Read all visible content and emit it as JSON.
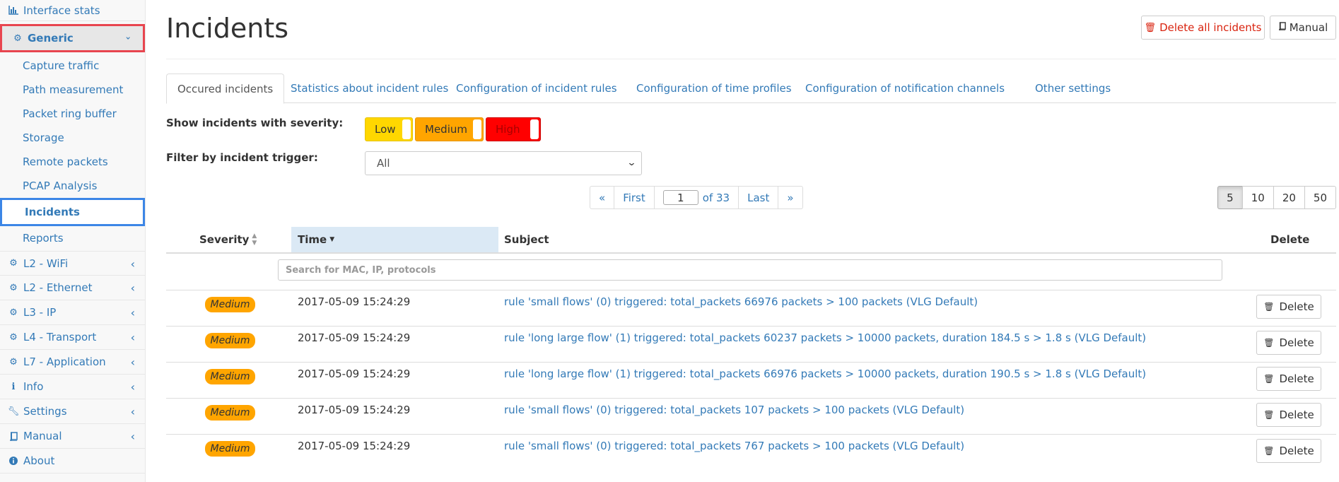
{
  "sidebar": {
    "items": [
      {
        "label": "Interface stats",
        "icon": "bar-chart-icon"
      },
      {
        "label": "Generic",
        "icon": "gear-icon"
      },
      {
        "label": "Capture traffic"
      },
      {
        "label": "Path measurement"
      },
      {
        "label": "Packet ring buffer"
      },
      {
        "label": "Storage"
      },
      {
        "label": "Remote packets"
      },
      {
        "label": "PCAP Analysis"
      },
      {
        "label": "Incidents"
      },
      {
        "label": "Reports"
      },
      {
        "label": "L2 - WiFi",
        "icon": "gear-icon"
      },
      {
        "label": "L2 - Ethernet",
        "icon": "gear-icon"
      },
      {
        "label": "L3 - IP",
        "icon": "gear-icon"
      },
      {
        "label": "L4 - Transport",
        "icon": "gear-icon"
      },
      {
        "label": "L7 - Application",
        "icon": "gear-icon"
      },
      {
        "label": "Info",
        "icon": "info-icon"
      },
      {
        "label": "Settings",
        "icon": "wrench-icon"
      },
      {
        "label": "Manual",
        "icon": "book-icon"
      },
      {
        "label": "About",
        "icon": "info-circle-icon"
      }
    ]
  },
  "header": {
    "title": "Incidents",
    "delete_all_label": "Delete all incidents",
    "manual_label": "Manual"
  },
  "tabs": [
    {
      "label": "Occured incidents"
    },
    {
      "label": "Statistics about incident rules"
    },
    {
      "label": "Configuration of incident rules"
    },
    {
      "label": "Configuration of time profiles"
    },
    {
      "label": "Configuration of notification channels"
    },
    {
      "label": "Other settings"
    }
  ],
  "filters": {
    "severity_label": "Show incidents with severity:",
    "severity_options": [
      "Low",
      "Medium",
      "High"
    ],
    "trigger_label": "Filter by incident trigger:",
    "trigger_value": "All"
  },
  "pagination": {
    "prev": "«",
    "first": "First",
    "current_page": "1",
    "of_pages": "of 33",
    "last": "Last",
    "next": "»",
    "page_sizes": [
      "5",
      "10",
      "20",
      "50"
    ],
    "active_page_size": "5"
  },
  "table": {
    "headers": {
      "severity": "Severity",
      "time": "Time",
      "subject": "Subject",
      "delete": "Delete"
    },
    "search_placeholder": "Search for MAC, IP, protocols",
    "delete_label": "Delete",
    "rows": [
      {
        "severity": "Medium",
        "time": "2017-05-09 15:24:29",
        "subject": "rule 'small flows' (0) triggered: total_packets 66976 packets > 100 packets (VLG Default)"
      },
      {
        "severity": "Medium",
        "time": "2017-05-09 15:24:29",
        "subject": "rule 'long large flow' (1) triggered: total_packets 60237 packets > 10000 packets, duration 184.5 s > 1.8 s (VLG Default)"
      },
      {
        "severity": "Medium",
        "time": "2017-05-09 15:24:29",
        "subject": "rule 'long large flow' (1) triggered: total_packets 66976 packets > 10000 packets, duration 190.5 s > 1.8 s (VLG Default)"
      },
      {
        "severity": "Medium",
        "time": "2017-05-09 15:24:29",
        "subject": "rule 'small flows' (0) triggered: total_packets 107 packets > 100 packets (VLG Default)"
      },
      {
        "severity": "Medium",
        "time": "2017-05-09 15:24:29",
        "subject": "rule 'small flows' (0) triggered: total_packets 767 packets > 100 packets (VLG Default)"
      }
    ]
  },
  "colors": {
    "link": "#337ab7",
    "low": "#ffd700",
    "medium": "#ffa500",
    "high": "#ff0000",
    "danger": "#d9230f"
  }
}
